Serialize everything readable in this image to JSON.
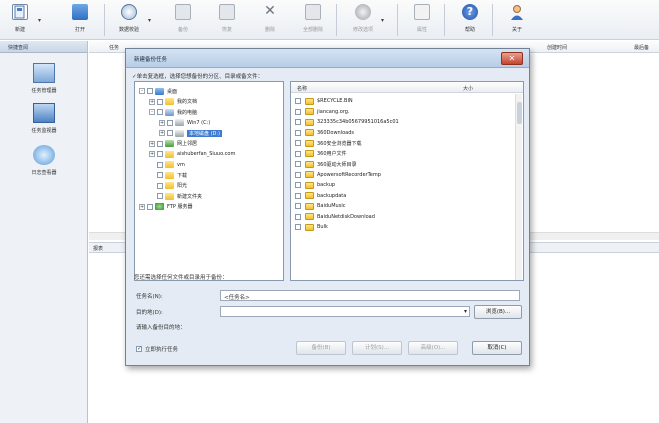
{
  "toolbar": {
    "buttons": [
      {
        "label": "新建",
        "icon": "new-task-icon",
        "enabled": true
      },
      {
        "label": "打开",
        "icon": "folder-open-icon",
        "enabled": true
      },
      {
        "label": "数据校验",
        "icon": "verify-icon",
        "enabled": true
      },
      {
        "label": "备份",
        "icon": "backup-icon",
        "enabled": false
      },
      {
        "label": "恢复",
        "icon": "restore-icon",
        "enabled": false
      },
      {
        "label": "删除",
        "icon": "delete-icon",
        "enabled": false
      },
      {
        "label": "全部删除",
        "icon": "delete-all-icon",
        "enabled": false
      },
      {
        "label": "修改选项",
        "icon": "settings-icon",
        "enabled": false
      },
      {
        "label": "属性",
        "icon": "properties-icon",
        "enabled": false
      },
      {
        "label": "帮助",
        "icon": "help-icon",
        "enabled": true
      },
      {
        "label": "关于",
        "icon": "about-icon",
        "enabled": true
      }
    ]
  },
  "left_panel": {
    "title": "快捷查阅",
    "items": [
      {
        "label": "任务管理器",
        "icon": "task-manager-icon"
      },
      {
        "label": "任务监视器",
        "icon": "task-monitor-icon"
      },
      {
        "label": "日志查看器",
        "icon": "log-viewer-icon"
      }
    ]
  },
  "grid": {
    "columns": [
      "任务",
      "创建时间",
      "最后备"
    ]
  },
  "bottom_panel": {
    "tab_label": "报表"
  },
  "dialog": {
    "title": "新建备份任务",
    "instruction": "✓单击复选框，选择您想备份的分区、目录或备文件：",
    "tree": [
      {
        "label": "桌面",
        "level": 0,
        "expander": "-",
        "icon": "desktop-icon"
      },
      {
        "label": "我的文档",
        "level": 1,
        "expander": "+",
        "icon": "folder-icon"
      },
      {
        "label": "我的电脑",
        "level": 1,
        "expander": "-",
        "icon": "computer-icon"
      },
      {
        "label": "Win7 (C:)",
        "level": 2,
        "expander": "+",
        "icon": "drive-icon"
      },
      {
        "label": "本地磁盘 (D:)",
        "level": 2,
        "expander": "+",
        "icon": "drive-icon",
        "selected": true
      },
      {
        "label": "网上邻居",
        "level": 1,
        "expander": "+",
        "icon": "network-icon"
      },
      {
        "label": "aishuberfan_Siuuo.com",
        "level": 1,
        "expander": "+",
        "icon": "folder-icon"
      },
      {
        "label": "vm",
        "level": 1,
        "expander": "",
        "icon": "folder-icon"
      },
      {
        "label": "下载",
        "level": 1,
        "expander": "",
        "icon": "folder-icon"
      },
      {
        "label": "阳光",
        "level": 1,
        "expander": "",
        "icon": "folder-icon"
      },
      {
        "label": "新建文件夹",
        "level": 1,
        "expander": "",
        "icon": "folder-icon"
      },
      {
        "label": "FTP 服务器",
        "level": 0,
        "expander": "+",
        "icon": "ftp-icon"
      }
    ],
    "file_list": {
      "header_name": "名称",
      "header_size": "大小",
      "files": [
        "$RECYCLE.BIN",
        "jiancang.org.",
        "323335c34b05679951016a5c01",
        "360Downloads",
        "360安全浏览器下载",
        "360用户文件",
        "360驱动大师目录",
        "ApowersoftRecorderTemp",
        "backup",
        "backupdata",
        "BaiduMusic",
        "BaiduNetdiskDownload",
        "Bulk"
      ]
    },
    "hint": "您还需选择任何文件或目录用于备份：",
    "task_name_label": "任务名(N):",
    "task_name_value": "<任务名>",
    "target_label": "目的地(D):",
    "target_value": "",
    "browse_button": "浏览(B)...",
    "instruction2": "请输入备份目的地：",
    "run_now_label": "立即执行任务",
    "run_now_checked": true,
    "buttons": {
      "backup_options": "备份(B)",
      "schedule": "计划(S)...",
      "advanced": "高级(O)...",
      "cancel": "取消(C)"
    }
  }
}
